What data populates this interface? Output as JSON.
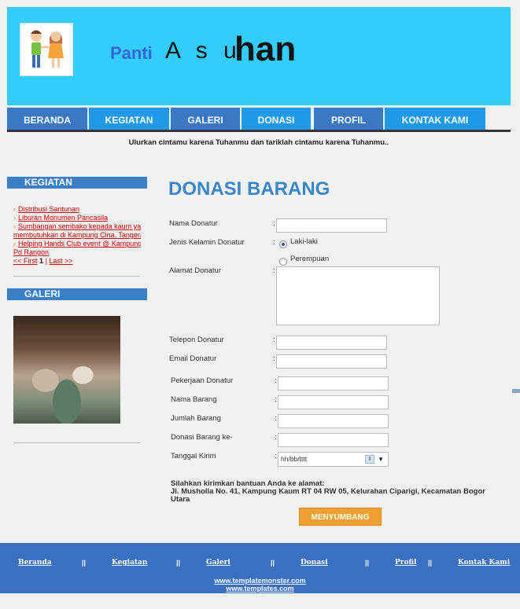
{
  "header": {
    "brand_part1": "Panti",
    "brand_part2": "A s u",
    "brand_part3": "han"
  },
  "nav": {
    "items": [
      "BERANDA",
      "KEGIATAN",
      "GALERI",
      "DONASI",
      "PROFIL",
      "KONTAK KAMI"
    ]
  },
  "tagline": "Ulurkan cintamu karena Tuhanmu dan tariklah cintamu karena Tuhanmu..",
  "sidebar": {
    "kegiatan_title": "KEGIATAN",
    "kegiatan_items": [
      "Distribusi Santunan",
      "Liburan Monumen Pancasila",
      "Sumbangan sembako kepada kaum yang",
      "membutuhkan di Kampung Cina, Tangerang",
      "Helping Hands Club event @ Kampung",
      "Pd Rangon"
    ],
    "pager_first": "<< First",
    "pager_current": "1",
    "pager_sep": "|",
    "pager_last": "Last >>",
    "galeri_title": "GALERI"
  },
  "form": {
    "title": "DONASI BARANG",
    "labels": {
      "nama": "Nama Donatur",
      "jenis_kelamin": "Jenis Kelamin Donatur",
      "alamat": "Alamat Donatur",
      "telepon": "Telepon Donatur",
      "email": "Email Donatur",
      "pekerjaan": "Pekerjaan Donatur",
      "nama_barang": "Nama Barang",
      "jumlah_barang": "Jumlah Barang",
      "donasi_ke": "Donasi Barang ke-",
      "tanggal_kirim": "Tanggal Kirim"
    },
    "colon": ":",
    "gender_options": [
      "Laki-laki",
      "Perempuan"
    ],
    "gender_selected": "Laki-laki",
    "date_placeholder": "hh/bb/tttt",
    "address_intro": "Silahkan kirimkan bantuan Anda ke alamat:",
    "address_line": "Jl. Musholla No. 41, Kampung Kaum RT 04 RW 05, Kelurahan Ciparigi, Kecamatan Bogor Utara",
    "submit_label": "MENYUMBANG"
  },
  "footer": {
    "links": [
      "Beranda",
      "Kegiatan",
      "Galeri",
      "Donasi",
      "Profil",
      "Kontak Kami"
    ],
    "separator": "||",
    "credit1": "www.templatemonster.com",
    "credit2": "www.templates.com"
  },
  "colors": {
    "header_bg": "#33ccff",
    "nav_bg": "#3a78c4",
    "nav_alt_bg": "#1e9ae8",
    "title_blue": "#3a86c8",
    "button_orange": "#f0a030",
    "footer_bg": "#3a70c2"
  }
}
